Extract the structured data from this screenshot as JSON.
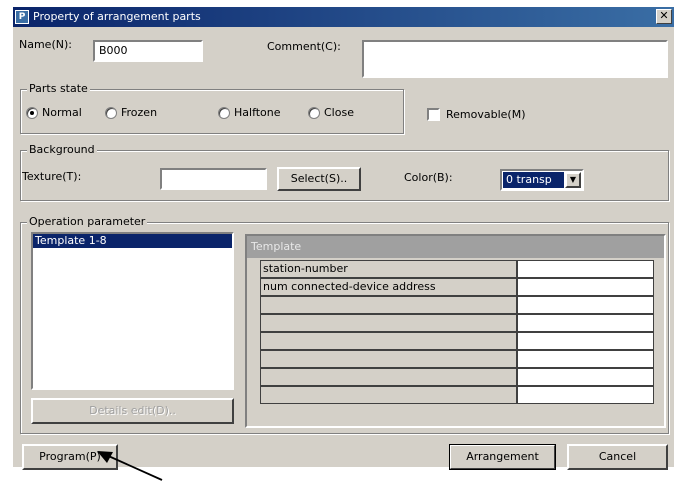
{
  "window": {
    "title": "Property of arrangement parts",
    "close_glyph": "✕",
    "icon": "app-icon"
  },
  "general": {
    "name_label": "Name(N):",
    "name_value": "B000",
    "comment_label": "Comment(C):",
    "comment_value": ""
  },
  "parts_state": {
    "group_label": "Parts state",
    "options": [
      "Normal",
      "Frozen",
      "Halftone",
      "Close"
    ],
    "selected": "Normal",
    "removable_label": "Removable(M)",
    "removable_checked": false
  },
  "background": {
    "group_label": "Background",
    "texture_label": "Texture(T):",
    "texture_value": "",
    "select_button": "Select(S)..",
    "color_label": "Color(B):",
    "color_value": "0 transp"
  },
  "operation": {
    "group_label": "Operation parameter",
    "list_items": [
      "Template 1-8"
    ],
    "details_button": "Details edit(D)..",
    "template_header": "Template",
    "template_rows": [
      {
        "label": "station-number",
        "value": ""
      },
      {
        "label": "num connected-device address",
        "value": ""
      },
      {
        "label": "",
        "value": ""
      },
      {
        "label": "",
        "value": ""
      },
      {
        "label": "",
        "value": ""
      },
      {
        "label": "",
        "value": ""
      },
      {
        "label": "",
        "value": ""
      },
      {
        "label": "",
        "value": ""
      }
    ]
  },
  "buttons": {
    "program": "Program(P)",
    "arrangement": "Arrangement",
    "cancel": "Cancel"
  }
}
